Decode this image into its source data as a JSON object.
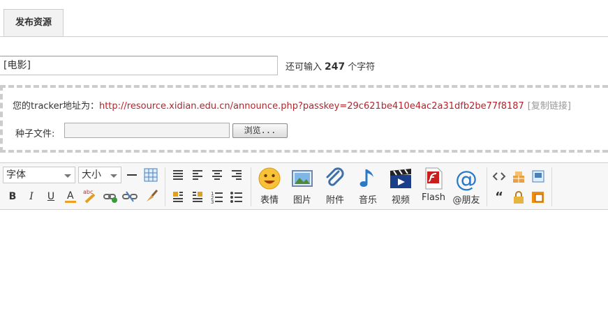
{
  "tab": {
    "label": "发布资源"
  },
  "title_field": {
    "value": "[电影]"
  },
  "counter": {
    "prefix": "还可输入",
    "count": "247",
    "suffix": "个字符"
  },
  "tracker": {
    "label": "您的tracker地址为：",
    "url": "http://resource.xidian.edu.cn/announce.php?passkey=29c621be410e4ac2a31dfb2be77f8187",
    "copy_link": "[复制链接]"
  },
  "torrent": {
    "label": "种子文件:",
    "browse_label": "浏览..."
  },
  "editor": {
    "font_select": "字体",
    "size_select": "大小",
    "big_buttons": [
      "表情",
      "图片",
      "附件",
      "音乐",
      "视频",
      "Flash",
      "@朋友"
    ]
  }
}
